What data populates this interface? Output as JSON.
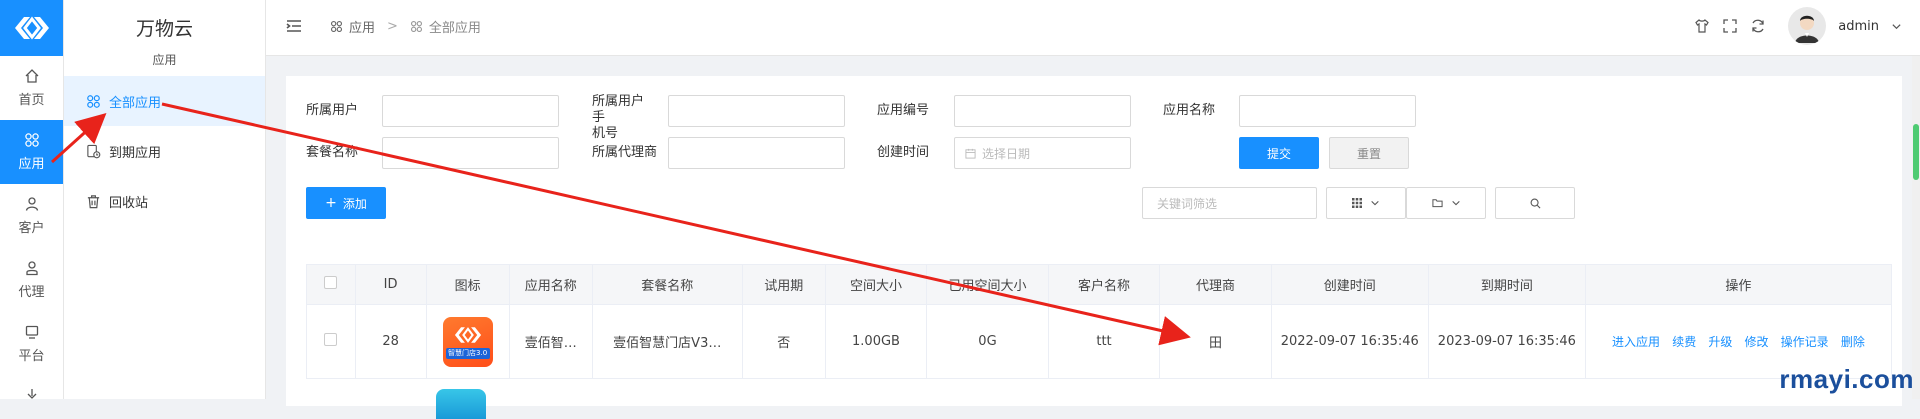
{
  "rail": {
    "items": [
      {
        "label": "首页",
        "icon": "home-icon"
      },
      {
        "label": "应用",
        "icon": "apps-icon"
      },
      {
        "label": "客户",
        "icon": "user-icon"
      },
      {
        "label": "代理",
        "icon": "agent-icon"
      },
      {
        "label": "平台",
        "icon": "monitor-icon"
      }
    ]
  },
  "sidebar": {
    "title": "万物云",
    "section": "应用",
    "items": [
      {
        "label": "全部应用",
        "icon": "apps-icon"
      },
      {
        "label": "到期应用",
        "icon": "expire-icon"
      },
      {
        "label": "回收站",
        "icon": "trash-icon"
      }
    ]
  },
  "header": {
    "breadcrumb": [
      "应用",
      "全部应用"
    ],
    "user": "admin"
  },
  "filters": {
    "owner_user": "所属用户",
    "owner_phone": "所属用户手\n机号",
    "app_no": "应用编号",
    "app_name": "应用名称",
    "package_name": "套餐名称",
    "agent": "所属代理商",
    "created_at": "创建时间",
    "date_placeholder": "选择日期",
    "submit": "提交",
    "reset": "重置"
  },
  "toolbar": {
    "add": "添加",
    "keyword_placeholder": "关键词筛选"
  },
  "table": {
    "headers": [
      "ID",
      "图标",
      "应用名称",
      "套餐名称",
      "试用期",
      "空间大小",
      "已用空间大小",
      "客户名称",
      "代理商",
      "创建时间",
      "到期时间",
      "操作"
    ],
    "rows": [
      {
        "id": "28",
        "icon_caption": "智慧门店3.0",
        "app_name": "壹佰智…",
        "package": "壹佰智慧门店V3…",
        "trial": "否",
        "space": "1.00GB",
        "used": "0G",
        "customer": "ttt",
        "agent": "田",
        "created": "2022-09-07 16:35:46",
        "expires": "2023-09-07 16:35:46",
        "actions": [
          "进入应用",
          "续费",
          "升级",
          "修改",
          "操作记录",
          "删除"
        ]
      }
    ]
  },
  "watermark": "rmayi.com",
  "colors": {
    "primary": "#1890ff",
    "arrow": "#e8231b",
    "watermark": "#1b4f9c"
  }
}
